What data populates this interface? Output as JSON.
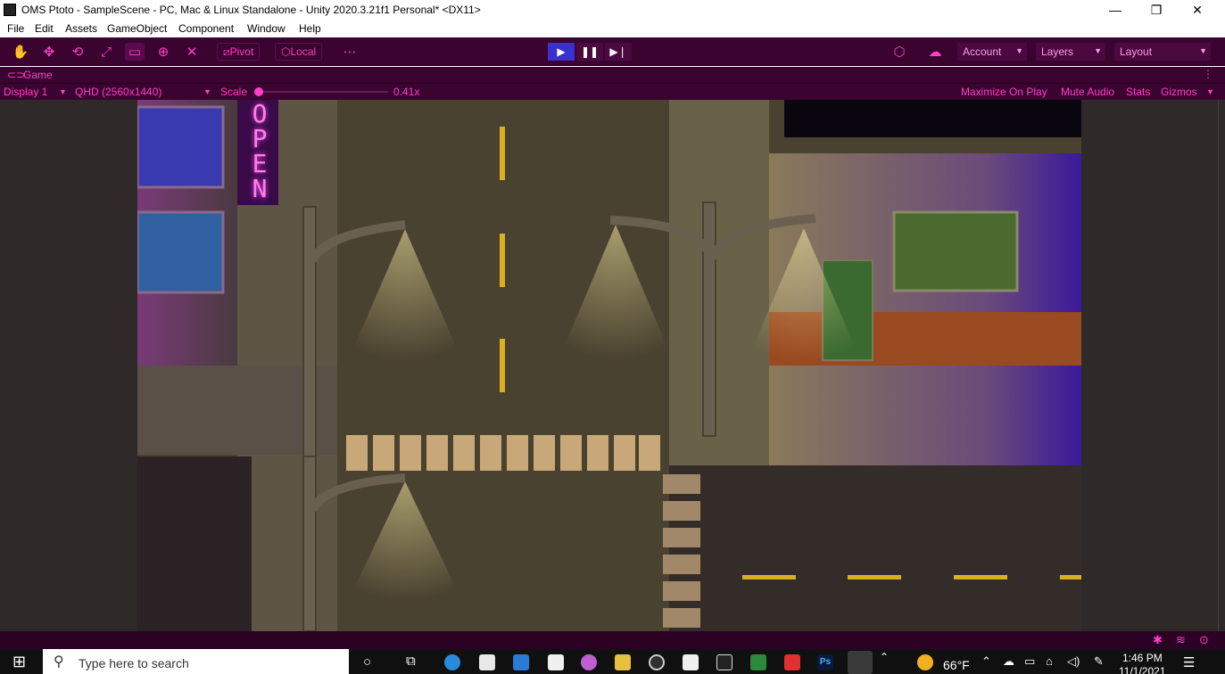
{
  "titlebar": {
    "title": "OMS Ptoto - SampleScene - PC, Mac & Linux Standalone - Unity 2020.3.21f1 Personal* <DX11>",
    "minimize": "—",
    "maximize": "❐",
    "close": "✕"
  },
  "menu": [
    "File",
    "Edit",
    "Assets",
    "GameObject",
    "Component",
    "Window",
    "Help"
  ],
  "toolbar": {
    "pivot_label": "Pivot",
    "local_label": "Local",
    "account_label": "Account",
    "layers_label": "Layers",
    "layout_label": "Layout"
  },
  "game_tab": {
    "label": "Game"
  },
  "game_bar": {
    "display": "Display 1",
    "resolution": "QHD (2560x1440)",
    "scale_label": "Scale",
    "scale_value": "0.41x",
    "maximize": "Maximize On Play",
    "mute": "Mute Audio",
    "stats": "Stats",
    "gizmos": "Gizmos"
  },
  "scene": {
    "neon_sign": "OPEN"
  },
  "taskbar": {
    "search_placeholder": "Type here to search",
    "temperature": "66°F",
    "time": "1:46 PM",
    "date": "11/1/2021"
  },
  "colors": {
    "accent": "#ff3fc8",
    "toolbar_bg": "#3a0330",
    "play_active": "#3a2fd0"
  }
}
